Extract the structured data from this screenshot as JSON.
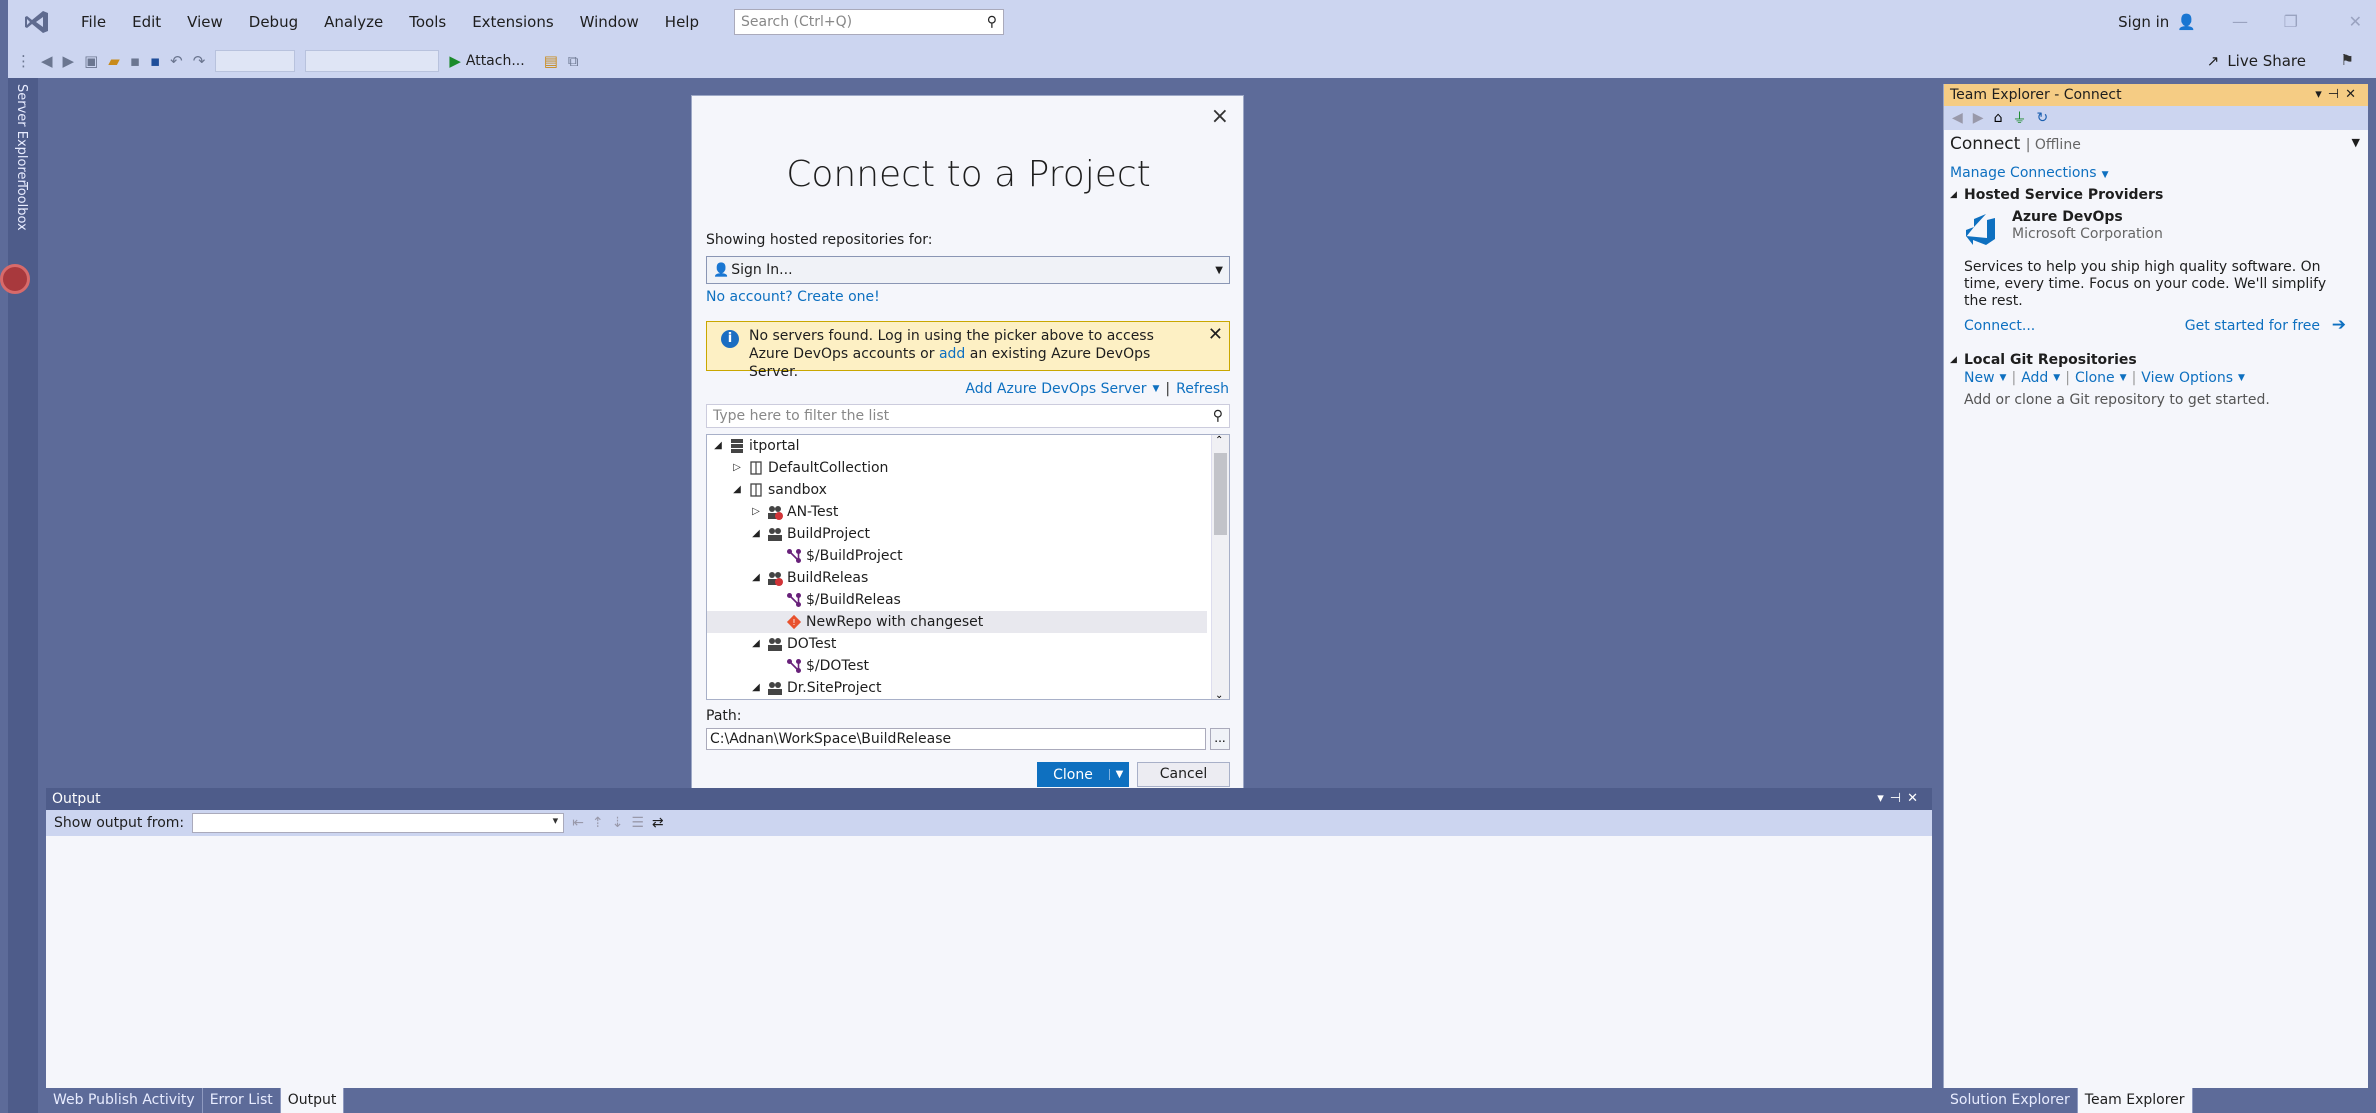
{
  "menubar": {
    "items": [
      "File",
      "Edit",
      "View",
      "Debug",
      "Analyze",
      "Tools",
      "Extensions",
      "Window",
      "Help"
    ],
    "search_placeholder": "Search (Ctrl+Q)",
    "sign_in": "Sign in"
  },
  "toolbar": {
    "attach_label": "Attach...",
    "live_share": "Live Share"
  },
  "side_tabs": [
    "Server Explorer",
    "Toolbox"
  ],
  "dialog": {
    "title": "Connect to a Project",
    "showing_label": "Showing hosted repositories for:",
    "account_selected": "Sign In...",
    "no_account_link": "No account? Create one!",
    "warning": {
      "text_before": "No servers found. Log in using the picker above to access Azure DevOps accounts or ",
      "link": "add",
      "text_after": " an existing Azure DevOps Server."
    },
    "add_server_link": "Add Azure DevOps Server",
    "refresh_link": "Refresh",
    "filter_placeholder": "Type here to filter the list",
    "tree": [
      {
        "label": "itportal",
        "level": 0,
        "expander": "expanded",
        "icon": "server-icon"
      },
      {
        "label": "DefaultCollection",
        "level": 1,
        "expander": "collapsed",
        "icon": "collection-icon"
      },
      {
        "label": "sandbox",
        "level": 1,
        "expander": "expanded",
        "icon": "collection-icon"
      },
      {
        "label": "AN-Test",
        "level": 2,
        "expander": "collapsed",
        "icon": "team-project-error-icon"
      },
      {
        "label": "BuildProject",
        "level": 2,
        "expander": "expanded",
        "icon": "team-project-icon"
      },
      {
        "label": "$/BuildProject",
        "level": 3,
        "expander": "none",
        "icon": "tfvc-repo-icon"
      },
      {
        "label": "BuildReleas",
        "level": 2,
        "expander": "expanded",
        "icon": "team-project-error-icon"
      },
      {
        "label": "$/BuildReleas",
        "level": 3,
        "expander": "none",
        "icon": "tfvc-repo-icon"
      },
      {
        "label": "NewRepo with changeset",
        "level": 3,
        "expander": "none",
        "icon": "git-repo-icon",
        "selected": true
      },
      {
        "label": "DOTest",
        "level": 2,
        "expander": "expanded",
        "icon": "team-project-icon"
      },
      {
        "label": "$/DOTest",
        "level": 3,
        "expander": "none",
        "icon": "tfvc-repo-icon"
      },
      {
        "label": "Dr.SiteProject",
        "level": 2,
        "expander": "expanded",
        "icon": "team-project-icon"
      }
    ],
    "path_label": "Path:",
    "path_value": "C:\\Adnan\\WorkSpace\\BuildRelease",
    "browse_label": "...",
    "clone_button": "Clone",
    "cancel_button": "Cancel"
  },
  "output": {
    "title": "Output",
    "show_from_label": "Show output from:"
  },
  "bottom_tabs": [
    "Web Publish Activity",
    "Error List",
    "Output"
  ],
  "team_explorer": {
    "title": "Team Explorer - Connect",
    "connect_label": "Connect",
    "status": "Offline",
    "manage_connections": "Manage Connections",
    "hosted_section": "Hosted Service Providers",
    "provider_name": "Azure DevOps",
    "provider_company": "Microsoft Corporation",
    "provider_desc": "Services to help you ship high quality software. On time, every time. Focus on your code. We'll simplify the rest.",
    "connect_link": "Connect...",
    "get_started_link": "Get started for free",
    "local_section": "Local Git Repositories",
    "local_actions": [
      "New",
      "Add",
      "Clone",
      "View Options"
    ],
    "local_hint": "Add or clone a Git repository to get started."
  },
  "right_bottom_tabs": [
    "Solution Explorer",
    "Team Explorer"
  ],
  "colors": {
    "accent": "#0e70c0",
    "warning_bg": "#fdf0c4",
    "panel_header": "#f5cc84"
  }
}
